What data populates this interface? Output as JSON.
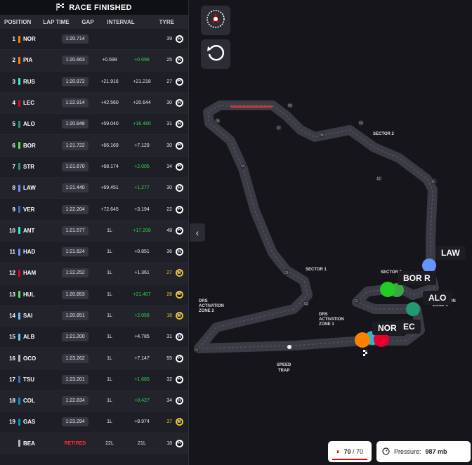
{
  "panel": {
    "title": "RACE FINISHED",
    "headers": {
      "position": "POSITION",
      "lap_time": "LAP TIME",
      "gap": "GAP",
      "interval": "INTERVAL",
      "tyre": "TYRE"
    },
    "rows": [
      {
        "pos": "1",
        "name": "NOR",
        "team": "#ff8000",
        "lap": "1:20.714",
        "gap": "",
        "int": "",
        "int_green": false,
        "laps": "39",
        "tyre": "H"
      },
      {
        "pos": "2",
        "name": "PIA",
        "team": "#ff8000",
        "lap": "1:20.663",
        "gap": "+0.698",
        "int": "+0.698",
        "int_green": true,
        "laps": "25",
        "tyre": "H"
      },
      {
        "pos": "3",
        "name": "RUS",
        "team": "#27f4d2",
        "lap": "1:20.972",
        "gap": "+21.916",
        "int": "+21.218",
        "int_green": false,
        "laps": "27",
        "tyre": "H"
      },
      {
        "pos": "4",
        "name": "LEC",
        "team": "#e8002d",
        "lap": "1:22.914",
        "gap": "+42.560",
        "int": "+20.644",
        "int_green": false,
        "laps": "30",
        "tyre": "H"
      },
      {
        "pos": "5",
        "name": "ALO",
        "team": "#229971",
        "lap": "1:20.848",
        "gap": "+59.040",
        "int": "+16.480",
        "int_green": true,
        "laps": "31",
        "tyre": "H"
      },
      {
        "pos": "6",
        "name": "BOR",
        "team": "#52e252",
        "lap": "1:21.722",
        "gap": "+66.169",
        "int": "+7.129",
        "int_green": false,
        "laps": "30",
        "tyre": "H"
      },
      {
        "pos": "7",
        "name": "STR",
        "team": "#229971",
        "lap": "1:21.670",
        "gap": "+68.174",
        "int": "+2.005",
        "int_green": true,
        "laps": "34",
        "tyre": "H"
      },
      {
        "pos": "8",
        "name": "LAW",
        "team": "#6692ff",
        "lap": "1:21.440",
        "gap": "+69.451",
        "int": "+1.277",
        "int_green": true,
        "laps": "30",
        "tyre": "H"
      },
      {
        "pos": "9",
        "name": "VER",
        "team": "#3671c6",
        "lap": "1:22.204",
        "gap": "+72.645",
        "int": "+3.194",
        "int_green": false,
        "laps": "22",
        "tyre": "H"
      },
      {
        "pos": "10",
        "name": "ANT",
        "team": "#27f4d2",
        "lap": "1:21.577",
        "gap": "1L",
        "int": "+17.208",
        "int_green": true,
        "laps": "48",
        "tyre": "H"
      },
      {
        "pos": "11",
        "name": "HAD",
        "team": "#6692ff",
        "lap": "1:21.624",
        "gap": "1L",
        "int": "+0.851",
        "int_green": false,
        "laps": "36",
        "tyre": "H"
      },
      {
        "pos": "12",
        "name": "HAM",
        "team": "#e8002d",
        "lap": "1:22.252",
        "gap": "1L",
        "int": "+1.361",
        "int_green": false,
        "laps": "27",
        "tyre": "M",
        "laps_yellow": true
      },
      {
        "pos": "13",
        "name": "HUL",
        "team": "#52e252",
        "lap": "1:20.853",
        "gap": "1L",
        "int": "+21.407",
        "int_green": true,
        "laps": "28",
        "tyre": "M",
        "laps_yellow": true
      },
      {
        "pos": "14",
        "name": "SAI",
        "team": "#64c4ff",
        "lap": "1:20.851",
        "gap": "1L",
        "int": "+2.058",
        "int_green": true,
        "laps": "18",
        "tyre": "M",
        "laps_yellow": true
      },
      {
        "pos": "15",
        "name": "ALB",
        "team": "#64c4ff",
        "lap": "1:21.200",
        "gap": "1L",
        "int": "+4.785",
        "int_green": false,
        "laps": "31",
        "tyre": "H"
      },
      {
        "pos": "16",
        "name": "OCO",
        "team": "#b6babd",
        "lap": "1:23.262",
        "gap": "1L",
        "int": "+7.147",
        "int_green": false,
        "laps": "55",
        "tyre": "H"
      },
      {
        "pos": "17",
        "name": "TSU",
        "team": "#3671c6",
        "lap": "1:23.201",
        "gap": "1L",
        "int": "+1.685",
        "int_green": true,
        "laps": "32",
        "tyre": "H"
      },
      {
        "pos": "18",
        "name": "COL",
        "team": "#0093cc",
        "lap": "1:22.834",
        "gap": "1L",
        "int": "+0.427",
        "int_green": true,
        "laps": "34",
        "tyre": "H"
      },
      {
        "pos": "19",
        "name": "GAS",
        "team": "#0093cc",
        "lap": "1:23.294",
        "gap": "1L",
        "int": "+8.974",
        "int_green": false,
        "laps": "37",
        "tyre": "M",
        "laps_yellow": true
      },
      {
        "pos": "",
        "name": "BEA",
        "team": "#b6babd",
        "lap": "",
        "retired": "RETIRED",
        "gap": "22L",
        "int": "21L",
        "int_green": false,
        "laps": "18",
        "tyre": "H"
      }
    ]
  },
  "map": {
    "sectors": [
      "SECTOR 1",
      "SECTOR 2",
      "SECTOR 3"
    ],
    "drs_zone_2": [
      "DRS",
      "ACTIVATION",
      "ZONE 2"
    ],
    "drs_zone_1": [
      "DRS",
      "ACTIVATION",
      "ZONE 1"
    ],
    "drs_zone_3_tail": [
      "CTION",
      "ZONE 1"
    ],
    "speed_trap": [
      "SPEED",
      "TRAP"
    ],
    "turns": [
      "01",
      "02",
      "03",
      "04",
      "05",
      "06",
      "07",
      "08",
      "09",
      "10",
      "11",
      "12",
      "13"
    ],
    "driver_tags": [
      "LAW",
      "BOR R",
      "ALO",
      "NOR",
      "EC"
    ]
  },
  "footer": {
    "lap_current": "70",
    "lap_total": "70",
    "pressure_label": "Pressure:",
    "pressure_value": "987 mb"
  },
  "icons": [
    "checkered-flag-icon",
    "compass-icon",
    "reset-icon",
    "chevron-left-icon",
    "lap-icon",
    "gauge-icon"
  ]
}
